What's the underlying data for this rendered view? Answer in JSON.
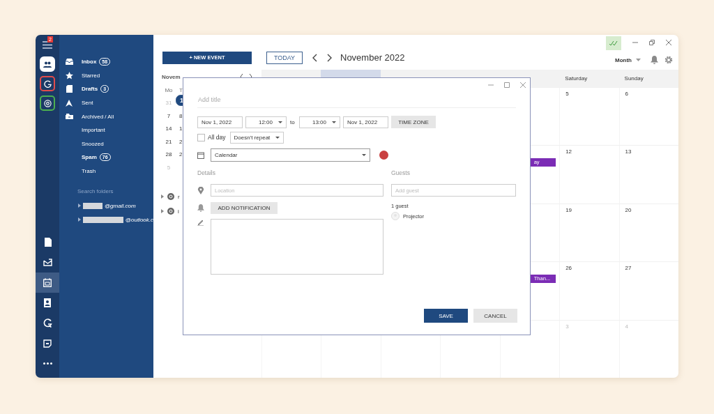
{
  "rail": {
    "menu_badge": "2",
    "accounts": [
      {
        "kind": "people",
        "color": "#ffffff"
      },
      {
        "kind": "g",
        "color": "#e04b4b"
      },
      {
        "kind": "at",
        "color": "#4caf50"
      }
    ],
    "apps": [
      {
        "kind": "notes",
        "selected": false
      },
      {
        "kind": "mail",
        "selected": false
      },
      {
        "kind": "calendar",
        "selected": true
      },
      {
        "kind": "contacts",
        "selected": false
      },
      {
        "kind": "sync",
        "selected": false
      },
      {
        "kind": "agenda",
        "selected": false
      },
      {
        "kind": "more",
        "selected": false
      }
    ]
  },
  "folders": [
    {
      "label": "Inbox",
      "count": "58",
      "unread": true,
      "kind": "inbox"
    },
    {
      "label": "Starred",
      "unread": false,
      "kind": "star"
    },
    {
      "label": "Drafts",
      "count": "3",
      "unread": true,
      "kind": "draft"
    },
    {
      "label": "Sent",
      "unread": false,
      "kind": "sent"
    },
    {
      "label": "Archived / All",
      "unread": false,
      "kind": "archive"
    },
    {
      "label": "Important",
      "unread": false
    },
    {
      "label": "Snoozed",
      "unread": false
    },
    {
      "label": "Spam",
      "count": "76",
      "unread": true
    },
    {
      "label": "Trash",
      "unread": false
    }
  ],
  "search_folders": "Search folders",
  "accounts": [
    {
      "address": "@gmail.com"
    },
    {
      "address": "@outlook.c"
    }
  ],
  "toolbar": {
    "new_event": "+ NEW EVENT",
    "today": "TODAY",
    "period": "November 2022",
    "view": "Month"
  },
  "mini_calendar": {
    "title": "Novem",
    "weekdays": [
      "Mo",
      "T"
    ],
    "weeks": [
      {
        "days": [
          "31",
          "1"
        ],
        "selected": true
      },
      {
        "days": [
          "7",
          "8"
        ],
        "selected": false
      },
      {
        "days": [
          "14",
          "1"
        ],
        "selected": false
      },
      {
        "days": [
          "21",
          "2"
        ],
        "selected": false
      },
      {
        "days": [
          "28",
          "2"
        ],
        "selected": false
      },
      {
        "days": [
          "5"
        ],
        "selected": false
      }
    ],
    "calendars": [
      {
        "label": "r"
      },
      {
        "label": "i"
      }
    ]
  },
  "month": {
    "columns": [
      {
        "selected": false
      },
      {
        "selected": true
      },
      {
        "selected": false
      },
      {
        "selected": false
      },
      {
        "selected": false
      },
      {
        "label": "Saturday",
        "selected": false
      },
      {
        "label": "Sunday",
        "selected": false
      }
    ],
    "weeks": [
      {
        "saturday": {
          "day": "5",
          "other_month": false
        },
        "sunday": {
          "day": "6",
          "other_month": false
        }
      },
      {
        "friday": {
          "event": "ay",
          "color": "#7b2cb5"
        },
        "saturday": {
          "day": "12",
          "other_month": false
        },
        "sunday": {
          "day": "13",
          "other_month": false
        }
      },
      {
        "saturday": {
          "day": "19",
          "other_month": false
        },
        "sunday": {
          "day": "20",
          "other_month": false
        }
      },
      {
        "friday": {
          "event": "Than...",
          "color": "#7b2cb5"
        },
        "saturday": {
          "day": "26",
          "other_month": false
        },
        "sunday": {
          "day": "27",
          "other_month": false
        }
      },
      {
        "saturday": {
          "day": "3",
          "other_month": true
        },
        "sunday": {
          "day": "4",
          "other_month": true
        }
      }
    ]
  },
  "dialog": {
    "title_placeholder": "Add title",
    "start_date": "Nov 1, 2022",
    "start_time": "12:00",
    "to": "to",
    "end_time": "13:00",
    "end_date": "Nov 1, 2022",
    "time_zone": "TIME ZONE",
    "all_day": {
      "label": "All day",
      "checked": false
    },
    "repeat": "Doesn't repeat",
    "calendar": "Calendar",
    "details": "Details",
    "location_placeholder": "Location",
    "add_notification": "ADD NOTIFICATION",
    "guests": "Guests",
    "guest_placeholder": "Add guest",
    "guest_count": "1 guest",
    "guest_list": [
      {
        "name": "Projector"
      }
    ],
    "save": "SAVE",
    "cancel": "CANCEL"
  }
}
